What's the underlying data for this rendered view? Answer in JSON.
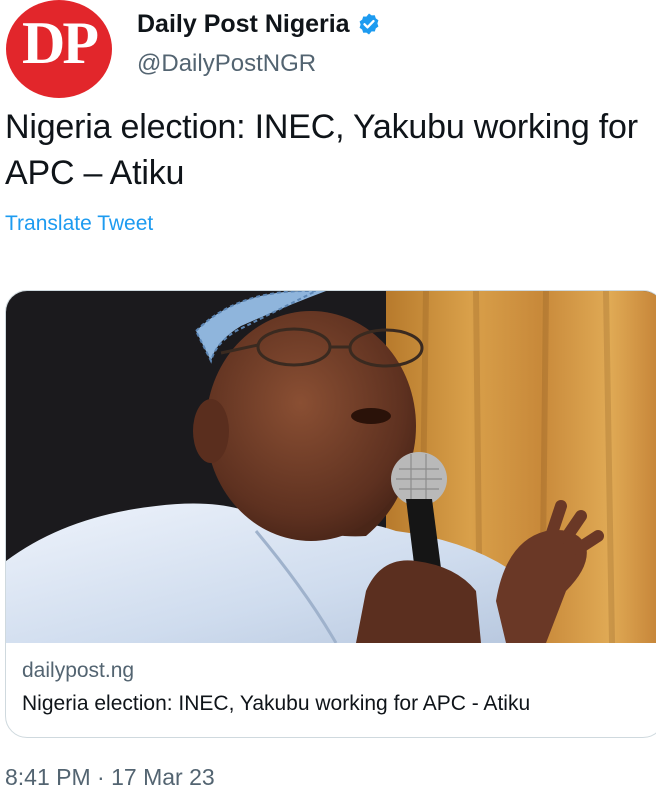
{
  "account": {
    "avatar_text": "DP",
    "display_name": "Daily Post Nigeria",
    "handle": "@DailyPostNGR",
    "verified": true
  },
  "tweet": {
    "text": "Nigeria election: INEC, Yakubu working for APC – Atiku",
    "translate_label": "Translate Tweet"
  },
  "link_card": {
    "domain": "dailypost.ng",
    "title": "Nigeria election: INEC, Yakubu working for APC - Atiku"
  },
  "timestamp": {
    "time": "8:41 PM",
    "separator": "·",
    "date": "17 Mar 23"
  },
  "colors": {
    "avatar_red": "#e2262b",
    "link_blue": "#1d9bf0",
    "secondary_text": "#536471",
    "card_border": "#cfd9de"
  },
  "icons": [
    "verified-badge-icon"
  ]
}
